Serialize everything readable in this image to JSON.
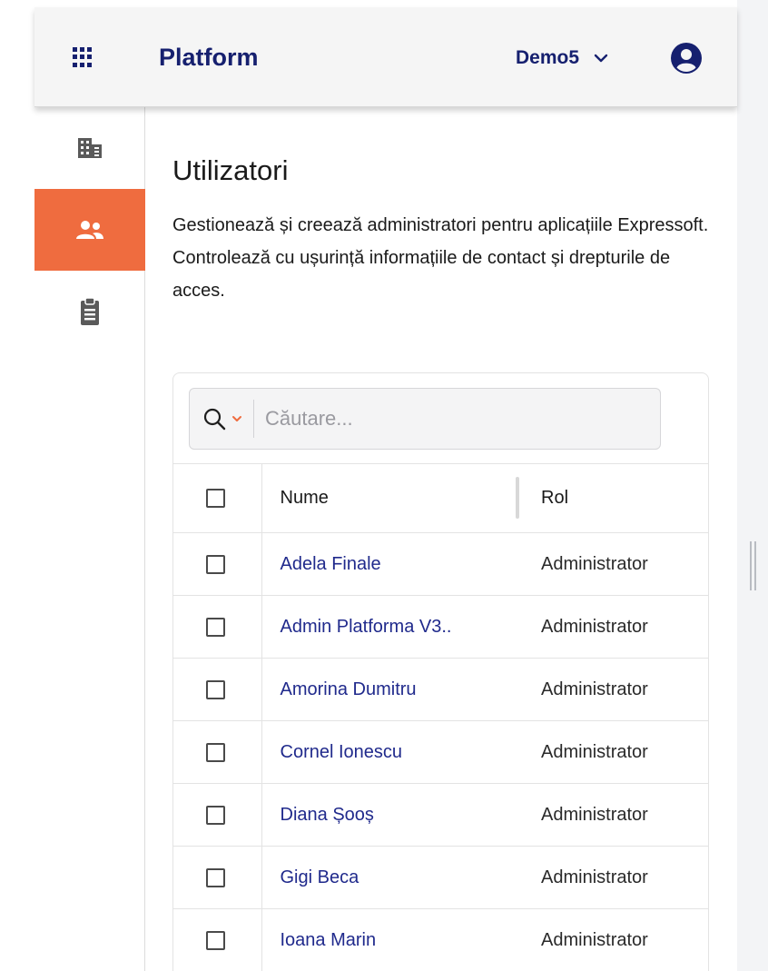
{
  "header": {
    "brand": "Platform",
    "tenant": "Demo5"
  },
  "icons": {
    "apps": "grid-icon",
    "chevron": "chevron-down-icon",
    "user": "user-circle-icon",
    "search": "search-icon"
  },
  "colors": {
    "brand": "#16206f",
    "accent": "#ef6c3f",
    "link": "#202a8c"
  },
  "sidebar": {
    "items": [
      {
        "icon": "building-icon",
        "active": false
      },
      {
        "icon": "users-icon",
        "active": true
      },
      {
        "icon": "clipboard-icon",
        "active": false
      }
    ]
  },
  "page": {
    "title": "Utilizatori",
    "description": "Gestionează și creează administratori pentru aplicațiile Expressoft. Controlează cu ușurință informațiile de contact și drepturile de acces."
  },
  "search": {
    "placeholder": "Căutare..."
  },
  "table": {
    "columns": {
      "name": "Nume",
      "role": "Rol"
    },
    "rows": [
      {
        "name": "Adela Finale",
        "role": "Administrator"
      },
      {
        "name": "Admin Platforma V3..",
        "role": "Administrator"
      },
      {
        "name": "Amorina Dumitru",
        "role": "Administrator"
      },
      {
        "name": "Cornel Ionescu",
        "role": "Administrator"
      },
      {
        "name": "Diana Șooș",
        "role": "Administrator"
      },
      {
        "name": "Gigi Beca",
        "role": "Administrator"
      },
      {
        "name": "Ioana Marin",
        "role": "Administrator"
      }
    ]
  }
}
